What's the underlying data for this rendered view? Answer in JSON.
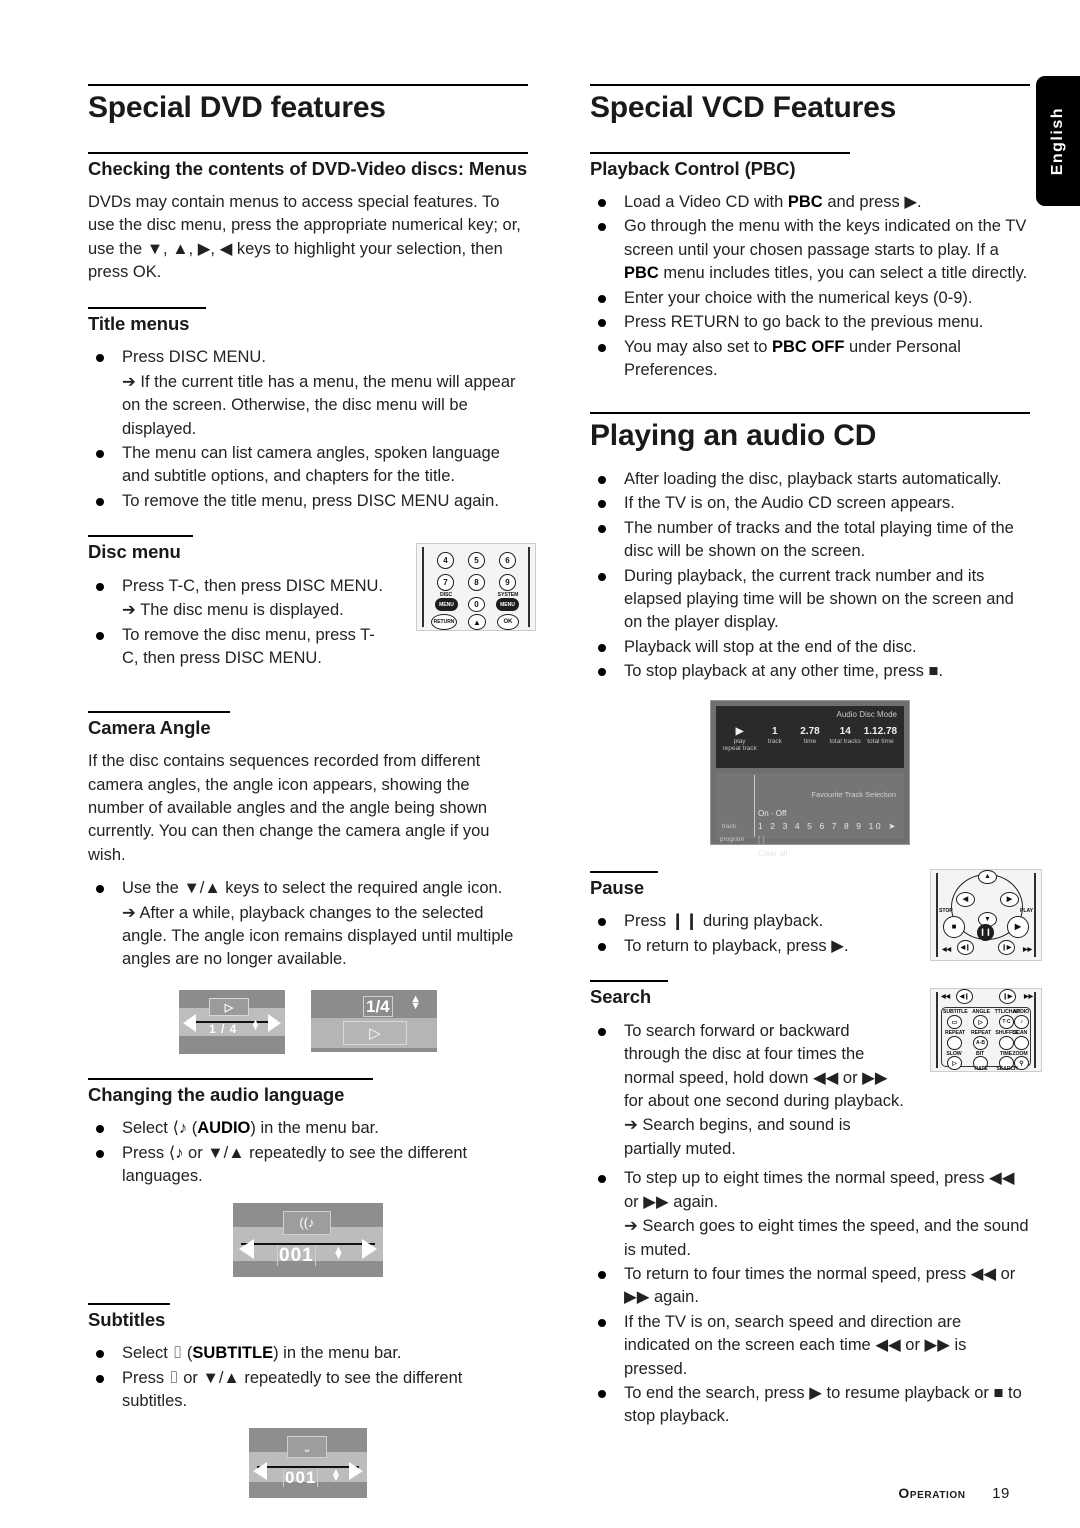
{
  "page": {
    "language_tab": "English",
    "footer_section": "Operation",
    "footer_page": "19"
  },
  "left_column": {
    "title": "Special DVD features",
    "sections": [
      {
        "heading": "Checking the contents of DVD-Video discs: Menus",
        "paragraph": "DVDs may contain menus to access special features. To use the disc menu, press the appropriate numerical key; or, use the ▼, ▲, ▶, ◀ keys to highlight your selection, then press OK."
      },
      {
        "heading": "Title menus",
        "bullets": [
          "Press DISC MENU.",
          "➔ If the current title has a menu, the menu will appear on the screen. Otherwise, the disc menu will be displayed.",
          "The menu can list camera angles, spoken language and subtitle options, and chapters for the title.",
          "To remove the title menu, press DISC MENU again."
        ]
      },
      {
        "heading": "Disc menu",
        "bullets": [
          "Press T-C, then press DISC MENU.",
          "➔ The disc menu is displayed.",
          "To remove the disc menu, press T-C, then press DISC MENU."
        ]
      },
      {
        "heading": "Camera Angle",
        "paragraph": "If the disc contains sequences recorded from different camera angles, the angle icon appears, showing the number of available angles and the angle being shown currently. You can then change the camera angle if you wish.",
        "bullets": [
          "Use the ▼/▲ keys to select the required angle icon.",
          "➔ After a while, playback changes to the selected angle. The angle  icon remains displayed until multiple angles are no longer available."
        ]
      },
      {
        "heading": "Changing the audio language",
        "bullets": [
          "Select ⟨♪ (AUDIO) in the menu bar.",
          "Press ⟨♪ or ▼/▲ repeatedly to see the different languages."
        ]
      },
      {
        "heading": "Subtitles",
        "bullets": [
          "Select ⌷ (SUBTITLE) in the menu bar.",
          "Press ⌷ or ▼/▲ repeatedly to see the different subtitles."
        ]
      }
    ],
    "figures": {
      "angle_bar_value": "1 / 4",
      "angle_box_value": "1/4",
      "audio_value": "001",
      "subtitle_value": "001"
    },
    "remote_numeric": {
      "keys": [
        "4",
        "5",
        "6",
        "7",
        "8",
        "9",
        "0"
      ],
      "labels": [
        "DISC",
        "MENU",
        "SYSTEM",
        "MENU",
        "RETURN",
        "OK"
      ]
    }
  },
  "right_column": {
    "titles": {
      "vcd": "Special VCD Features",
      "audio_cd": "Playing an audio CD"
    },
    "sections": [
      {
        "heading": "Playback Control (PBC)",
        "bullets": [
          "Load a Video CD with PBC and press ▶.",
          "Go through the menu with the keys indicated on the TV screen until your chosen passage starts to play. If a PBC menu includes titles, you can select a title directly.",
          "Enter your choice with the numerical keys (0-9).",
          "Press RETURN to go back to the previous menu.",
          "You may also set to PBC OFF under Personal Preferences."
        ]
      },
      {
        "heading": "",
        "bullets": [
          "After loading the disc, playback starts automatically.",
          "If the TV is on, the Audio CD screen appears.",
          "The number of tracks and the total playing time of the disc will be shown on the screen.",
          "During playback, the current track number and its elapsed playing time will be shown on the screen and on the player display.",
          "Playback will stop at the end of the disc.",
          "To stop playback at any other time, press ■."
        ]
      },
      {
        "heading": "Pause",
        "bullets": [
          "Press ❙❙ during playback.",
          "To return to playback, press ▶."
        ]
      },
      {
        "heading": "Search",
        "bullets": [
          "To search forward or backward through the disc at four times the normal speed, hold down ◀◀ or ▶▶ for about one second during playback.",
          "➔ Search begins, and sound is partially muted.",
          "To step up to eight times the normal speed, press ◀◀ or ▶▶ again.",
          "➔ Search goes to eight times the speed, and the sound is muted.",
          "To return to four times the normal speed, press ◀◀ or ▶▶ again.",
          "If the TV is on, search speed and direction are indicated on the screen each time ◀◀ or ▶▶ is pressed.",
          "To end the search, press ▶ to resume playback or ■ to stop playback."
        ]
      }
    ],
    "audio_disc_screen": {
      "mode": "Audio Disc Mode",
      "stats": [
        {
          "value": "▶",
          "label": "play",
          "label2": "repeat track"
        },
        {
          "value": "1",
          "label": "track",
          "label2": ""
        },
        {
          "value": "2.78",
          "label": "time",
          "label2": ""
        },
        {
          "value": "14",
          "label": "total tracks",
          "label2": ""
        },
        {
          "value": "1.12.78",
          "label": "total time",
          "label2": ""
        }
      ],
      "fts_title": "Favourite Track Selection",
      "on_off": "On · Off",
      "track_label": "track",
      "program_label": "program",
      "track_numbers": "1 2 3 4 5  6 7 8 9 10 ➤",
      "program_value": "[ ]",
      "clear_all": "Clear all"
    },
    "remote_nav": {
      "labels": [
        "STOP",
        "PLAY"
      ]
    },
    "remote_fn": {
      "row_top": [
        "SUBTITLE",
        "ANGLE",
        "TTL/CHAP",
        "AUDIO"
      ],
      "row1_labels": [
        "REPEAT",
        "REPEAT",
        "SHUFFLE",
        "SCAN"
      ],
      "row2_labels": [
        "SLOW",
        "BIT",
        "TIME",
        "ZOOM"
      ],
      "row3_labels": [
        "RATE",
        "SEARCH"
      ],
      "ab_key": "A-B"
    }
  }
}
